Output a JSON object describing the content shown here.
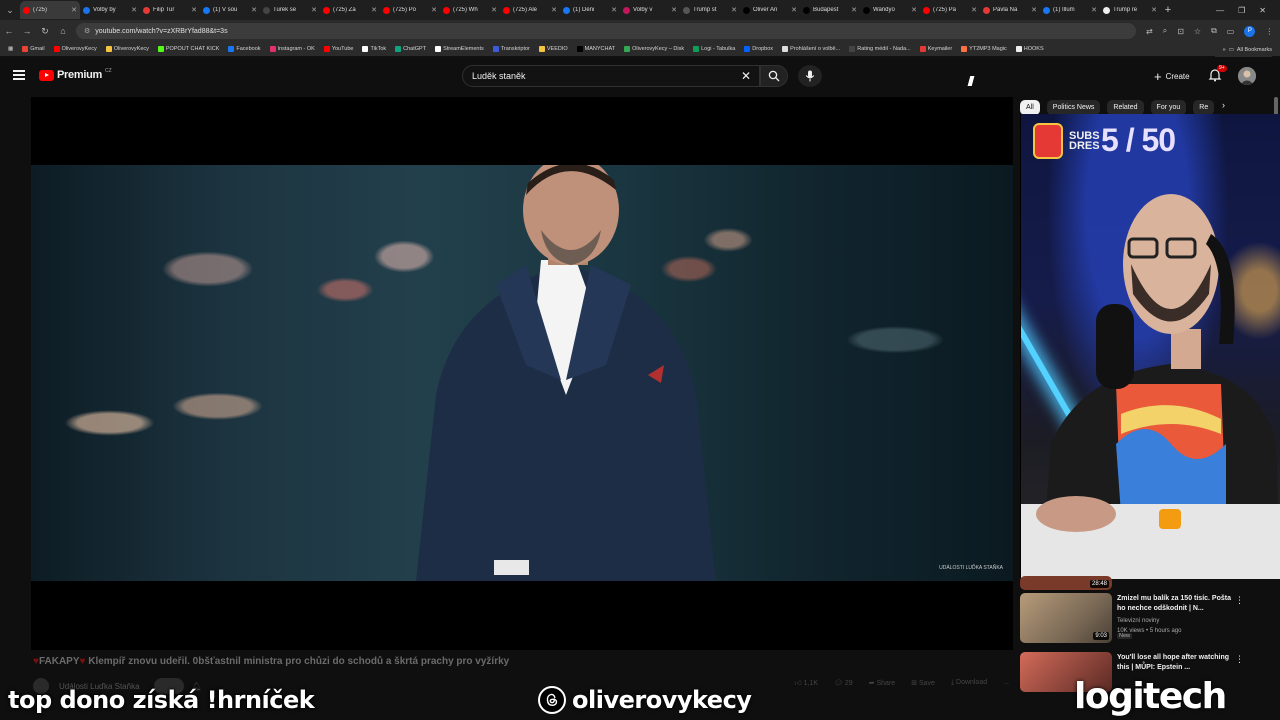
{
  "browser": {
    "tabs": [
      {
        "label": "(725)",
        "color": "#ff0000",
        "active": true
      },
      {
        "label": "Volby by",
        "color": "#1a73e8"
      },
      {
        "label": "Filip Tur",
        "color": "#e53935"
      },
      {
        "label": "(1) V sou",
        "color": "#1877f2"
      },
      {
        "label": "Turek se",
        "color": "#444444"
      },
      {
        "label": "(725) Za",
        "color": "#ff0000"
      },
      {
        "label": "(725) Po",
        "color": "#ff0000"
      },
      {
        "label": "(725) Wh",
        "color": "#ff0000"
      },
      {
        "label": "(725) Ale",
        "color": "#ff0000"
      },
      {
        "label": "(1) Deni",
        "color": "#1877f2"
      },
      {
        "label": "Volby v",
        "color": "#c2185b"
      },
      {
        "label": "Trump st",
        "color": "#555555"
      },
      {
        "label": "Oliver An",
        "color": "#000000"
      },
      {
        "label": "Budapest",
        "color": "#000000"
      },
      {
        "label": "Wandyo",
        "color": "#000000"
      },
      {
        "label": "(725) Pa",
        "color": "#ff0000"
      },
      {
        "label": "Pavla Na",
        "color": "#e53935"
      },
      {
        "label": "(1) Illum",
        "color": "#1877f2"
      },
      {
        "label": "Trump re",
        "color": "#eeeeee"
      }
    ],
    "url": "youtube.com/watch?v=zXRBrYfad88&t=3s",
    "bookmarks": [
      {
        "label": "Gmail",
        "color": "#ea4335"
      },
      {
        "label": "OliverovyKecy",
        "color": "#ff0000"
      },
      {
        "label": "OliverovyKecy",
        "color": "#f5c542"
      },
      {
        "label": "POPOUT CHAT KICK",
        "color": "#53fc18"
      },
      {
        "label": "Facebook",
        "color": "#1877f2"
      },
      {
        "label": "Instagram - OK",
        "color": "#e1306c"
      },
      {
        "label": "YouTube",
        "color": "#ff0000"
      },
      {
        "label": "TikTok",
        "color": "#ffffff"
      },
      {
        "label": "ChatGPT",
        "color": "#10a37f"
      },
      {
        "label": "StreamElements",
        "color": "#ffffff"
      },
      {
        "label": "Transkriptor",
        "color": "#3b5bdb"
      },
      {
        "label": "VEEDIO",
        "color": "#f5c542"
      },
      {
        "label": "MANYCHAT",
        "color": "#000000"
      },
      {
        "label": "OliverovyKecy – Disk",
        "color": "#34a853"
      },
      {
        "label": "Logi - Tabulka",
        "color": "#0f9d58"
      },
      {
        "label": "Dropbox",
        "color": "#0061ff"
      },
      {
        "label": "Prohlášení o volbě...",
        "color": "#dddddd"
      },
      {
        "label": "Rating médií - Nada...",
        "color": "#444444"
      },
      {
        "label": "Keymailer",
        "color": "#e53935"
      },
      {
        "label": "YT2MP3 Magic",
        "color": "#ff7043"
      },
      {
        "label": "HOOKS",
        "color": "#eeeeee"
      }
    ],
    "all_bookmarks": "All Bookmarks"
  },
  "header": {
    "logo_text": "Premium",
    "logo_country": "CZ",
    "search_value": "Luděk staněk",
    "create_label": "Create",
    "notifications_badge": "9+"
  },
  "video": {
    "title_prefix": "FAKAPY",
    "title": "Klempíř znovu udeřil. 0bšťastnil ministra pro chůzi do schodů a škrtá prachy pro vyžírky",
    "channel": "Události Luďka Staňka",
    "watermark": "UDÁLOSTI LUĎKA STAŇKA",
    "likes": "1,1K",
    "comments": "29",
    "share_label": "Share",
    "save_label": "Save",
    "download_label": "Download",
    "more_label": "..."
  },
  "chips": [
    "All",
    "Politics News",
    "Related",
    "For you",
    "Re"
  ],
  "webcam": {
    "subs_label": "SUBS DRES",
    "subs_count": "5 / 50"
  },
  "recommendations": [
    {
      "duration": "28:48"
    },
    {
      "title": "Zmizel mu balík za 150 tisíc. Pošta ho nechce odškodnit | N...",
      "channel": "Televizní noviny",
      "stats": "10K views • 5 hours ago",
      "badge": "New",
      "duration": "9:03"
    },
    {
      "title": "You'll lose all hope after watching this | MŮPI: Epstein ..."
    }
  ],
  "overlay": {
    "left_text": "top dono získá !hrníček",
    "handle": "oliverovykecy",
    "brand": "logitech"
  },
  "colors": {
    "accent": "#ff0000",
    "background": "#0f0f0f"
  }
}
